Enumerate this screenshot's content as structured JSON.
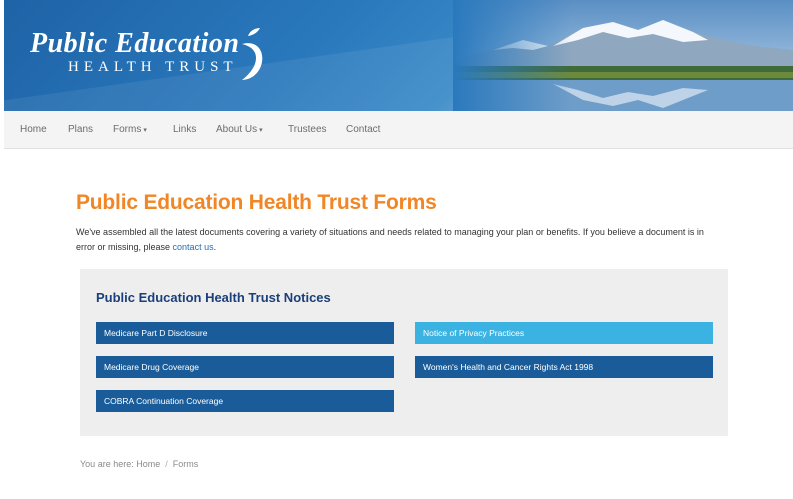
{
  "header": {
    "logo_line1": "Public Education",
    "logo_line2": "HEALTH TRUST"
  },
  "nav": {
    "items": [
      {
        "label": "Home"
      },
      {
        "label": "Plans"
      },
      {
        "label": "Forms"
      },
      {
        "label": "Links"
      },
      {
        "label": "About Us"
      },
      {
        "label": "Trustees"
      },
      {
        "label": "Contact"
      }
    ],
    "caret": "▾"
  },
  "main": {
    "title": "Public Education Health Trust Forms",
    "intro_text": "We've assembled all the latest documents covering a variety of situations and needs related to managing your plan or benefits. If you believe a document is in error or missing, please ",
    "intro_link": "contact us",
    "intro_end": "."
  },
  "notices": {
    "title": "Public Education Health Trust Notices",
    "buttons": [
      {
        "label": "Medicare Part D Disclosure"
      },
      {
        "label": "Notice of Privacy Practices"
      },
      {
        "label": "Medicare Drug Coverage"
      },
      {
        "label": "Women's Health and Cancer Rights Act 1998"
      },
      {
        "label": "COBRA Continuation Coverage"
      }
    ]
  },
  "breadcrumb": {
    "prefix": "You are here:",
    "items": [
      {
        "label": "Home"
      },
      {
        "label": "Forms"
      }
    ],
    "separator": "/"
  },
  "colors": {
    "title_orange": "#f18626",
    "notice_title_navy": "#1b3f7a",
    "button_dark_blue": "#1a5c99",
    "button_light_blue": "#3ab3e3",
    "header_blue": "#1e63a6"
  }
}
